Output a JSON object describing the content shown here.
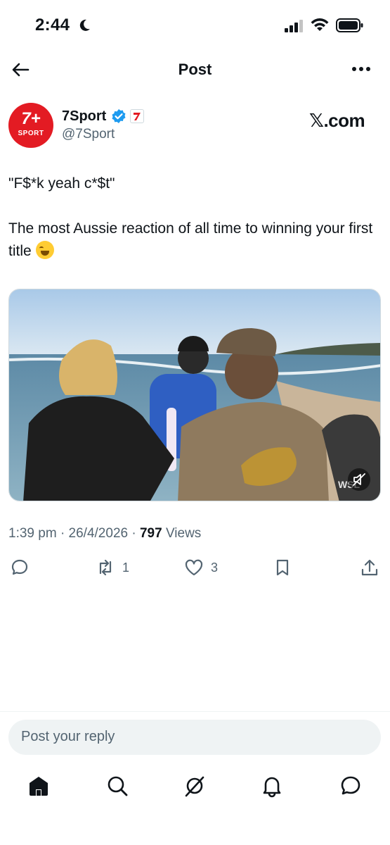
{
  "status_bar": {
    "time": "2:44"
  },
  "topbar": {
    "title": "Post"
  },
  "author": {
    "avatar_top": "7+",
    "avatar_bottom": "SPORT",
    "name": "7Sport",
    "handle": "@7Sport",
    "source_label": "𝕏.com"
  },
  "tweet": {
    "line1": "\"F$*k yeah c*$t\"",
    "line2": "The most Aussie reaction of all time to winning your first title",
    "emoji": "face-with-tears-of-joy"
  },
  "media": {
    "watermark": "WSL"
  },
  "meta": {
    "time": "1:39 pm",
    "date": "26/4/2026",
    "views_count": "797",
    "views_label": "Views",
    "sep": "·"
  },
  "actions": {
    "retweets": "1",
    "likes": "3"
  },
  "reply": {
    "placeholder": "Post your reply"
  },
  "colors": {
    "accent": "#1d9bf0",
    "brand_red": "#e31b23",
    "muted": "#536471"
  }
}
